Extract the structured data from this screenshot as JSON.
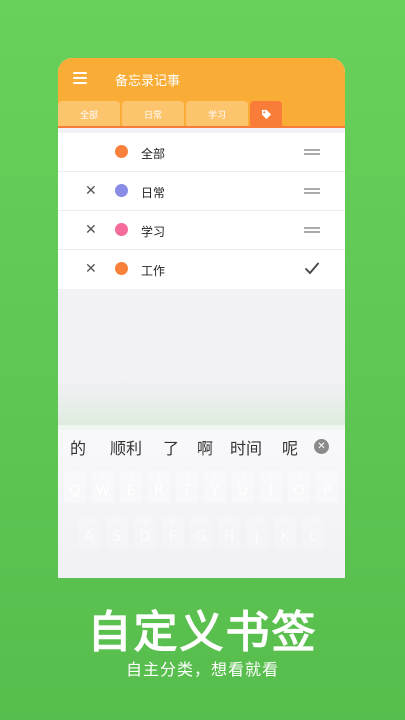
{
  "app": {
    "title": "备忘录记事",
    "tabs": [
      {
        "label": "全部"
      },
      {
        "label": "日常"
      },
      {
        "label": "学习"
      }
    ],
    "active_tab_icon": "tag-icon",
    "accent_color": "#f9ad36",
    "active_color": "#f97d38"
  },
  "tags": [
    {
      "label": "全部",
      "color": "#f7813a",
      "deletable": false,
      "action": "drag"
    },
    {
      "label": "日常",
      "color": "#8a8de6",
      "deletable": true,
      "action": "drag"
    },
    {
      "label": "学习",
      "color": "#f46c9b",
      "deletable": true,
      "action": "drag"
    },
    {
      "label": "工作",
      "color": "#f7813a",
      "deletable": true,
      "action": "check"
    }
  ],
  "keyboard": {
    "candidates": [
      "的",
      "顺利",
      "了",
      "啊",
      "时间",
      "呢"
    ],
    "row1": [
      {
        "num": "1",
        "ch": "Q"
      },
      {
        "num": "2",
        "ch": "W"
      },
      {
        "num": "3",
        "ch": "E"
      },
      {
        "num": "4",
        "ch": "R"
      },
      {
        "num": "5",
        "ch": "T"
      },
      {
        "num": "6",
        "ch": "Y"
      },
      {
        "num": "7",
        "ch": "U"
      },
      {
        "num": "8",
        "ch": "I"
      },
      {
        "num": "9",
        "ch": "O"
      },
      {
        "num": "0",
        "ch": "P"
      }
    ],
    "row2": [
      {
        "num": "~",
        "ch": "A"
      },
      {
        "num": "!",
        "ch": "S"
      },
      {
        "num": "@",
        "ch": "D"
      },
      {
        "num": "#",
        "ch": "F"
      },
      {
        "num": "%",
        "ch": "G"
      },
      {
        "num": "\"",
        "ch": "H"
      },
      {
        "num": "\"",
        "ch": "J"
      },
      {
        "num": "*",
        "ch": "K"
      },
      {
        "num": "?",
        "ch": "L"
      }
    ]
  },
  "promo": {
    "headline": "自定义书签",
    "subline": "自主分类，想看就看"
  }
}
